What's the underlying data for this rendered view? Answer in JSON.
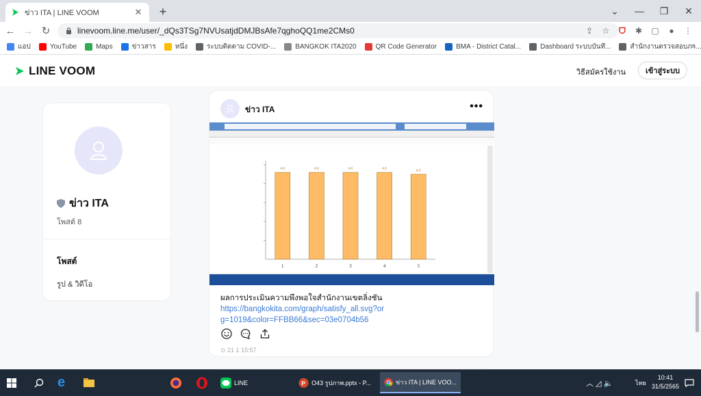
{
  "browser": {
    "tab_title": "ข่าว ITA | LINE VOOM",
    "url": "linevoom.line.me/user/_dQs3TSg7NVUsatjdDMJBsAfe7qghoQQ1me2CMs0"
  },
  "bookmarks": [
    {
      "label": "แอป",
      "color": "#4285f4"
    },
    {
      "label": "YouTube",
      "color": "#ff0000"
    },
    {
      "label": "Maps",
      "color": "#34a853"
    },
    {
      "label": "ข่าวสาร",
      "color": "#1a73e8"
    },
    {
      "label": "หนึ่ง",
      "color": "#fbbc04"
    },
    {
      "label": "ระบบติดตาม COVID-...",
      "color": "#5f6368"
    },
    {
      "label": "BANGKOK ITA2020",
      "color": "#888"
    },
    {
      "label": "QR Code Generator",
      "color": "#e53935"
    },
    {
      "label": "BMA - District Catal...",
      "color": "#1565c0"
    },
    {
      "label": "Dashboard ระบบบันทึ...",
      "color": "#5f6368"
    },
    {
      "label": "สำนักงานตรวจสอบภา...",
      "color": "#5f6368"
    }
  ],
  "header": {
    "logo": "LINE VOOM",
    "signup": "วิธีสมัครใช้งาน",
    "login": "เข้าสู่ระบบ"
  },
  "profile": {
    "name": "ข่าว ITA",
    "post_count": "โพสต์ 8",
    "section_posts": "โพสต์",
    "section_photos": "รูป & วิดีโอ"
  },
  "post": {
    "author": "ข่าว ITA",
    "more": "•••",
    "text": "ผลการประเมินความพึงพอใจสำนักงานเขตลิ่งชัน",
    "link": "https://bangkokita.com/graph/satisfy_all.svg?org=1019&color=FFBB66&sec=03e0704b56",
    "time": "21 1 15:57"
  },
  "chart_data": {
    "type": "bar",
    "categories": [
      "1",
      "2",
      "3",
      "4",
      "5"
    ],
    "values": [
      4.6,
      4.6,
      4.6,
      4.6,
      4.5
    ],
    "ylim": [
      0,
      5
    ],
    "bar_color": "#FFBB66"
  },
  "taskbar": {
    "apps": [
      {
        "label": "LINE"
      },
      {
        "label": "O43 รูปภาพ.pptx - P..."
      },
      {
        "label": "ข่าว ITA | LINE VOO..."
      }
    ],
    "lang": "ไทย",
    "time": "10:41",
    "date": "31/5/2565"
  }
}
